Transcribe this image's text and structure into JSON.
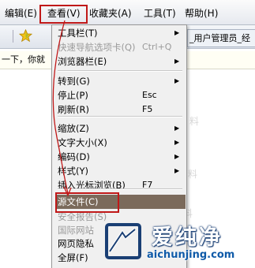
{
  "menubar": {
    "items": [
      "编辑(E)",
      "查看(V)",
      "收藏夹(A)",
      "工具(T)",
      "帮助(H)"
    ]
  },
  "toolbar": {
    "tab_title": "_用户管理员_经",
    "info_bar_text": "一下，你就"
  },
  "view_menu": {
    "items": [
      {
        "label": "工具栏(T)",
        "shortcut": "",
        "submenu": true,
        "disabled": false
      },
      {
        "label": "快速导航选项卡(Q)",
        "shortcut": "Ctrl+Q",
        "submenu": false,
        "disabled": true
      },
      {
        "label": "浏览器栏(E)",
        "shortcut": "",
        "submenu": true,
        "disabled": false
      },
      {
        "label": "转到(G)",
        "shortcut": "",
        "submenu": true,
        "disabled": false
      },
      {
        "label": "停止(P)",
        "shortcut": "Esc",
        "submenu": false,
        "disabled": false
      },
      {
        "label": "刷新(R)",
        "shortcut": "F5",
        "submenu": false,
        "disabled": false
      },
      {
        "label": "缩放(Z)",
        "shortcut": "",
        "submenu": true,
        "disabled": false
      },
      {
        "label": "文字大小(X)",
        "shortcut": "",
        "submenu": true,
        "disabled": false
      },
      {
        "label": "编码(D)",
        "shortcut": "",
        "submenu": true,
        "disabled": false
      },
      {
        "label": "样式(Y)",
        "shortcut": "",
        "submenu": true,
        "disabled": false
      },
      {
        "label": "插入光标浏览(B)",
        "shortcut": "F7",
        "submenu": false,
        "disabled": false
      },
      {
        "label": "源文件(C)",
        "shortcut": "",
        "submenu": false,
        "disabled": false,
        "highlighted": true
      },
      {
        "label": "安全报告(S)",
        "shortcut": "",
        "submenu": false,
        "disabled": true
      },
      {
        "label": "国际网站",
        "shortcut": "",
        "submenu": false,
        "disabled": true
      },
      {
        "label": "网页隐私",
        "shortcut": "",
        "submenu": false,
        "disabled": false
      },
      {
        "label": "全屏(F)",
        "shortcut": "",
        "submenu": false,
        "disabled": false
      }
    ]
  },
  "background": {
    "ghost_1": "料",
    "ghost_2": "料",
    "ghost_3": "料"
  },
  "watermark": {
    "title": "爱纯净",
    "url": "aichunjing.com"
  },
  "colors": {
    "highlight": "#7b6a5b",
    "annotation_red": "#c01818",
    "watermark_blue": "#0f5aa8"
  },
  "icons": [
    "star-icon",
    "submenu-arrow-icon",
    "watermark-logo-icon"
  ]
}
